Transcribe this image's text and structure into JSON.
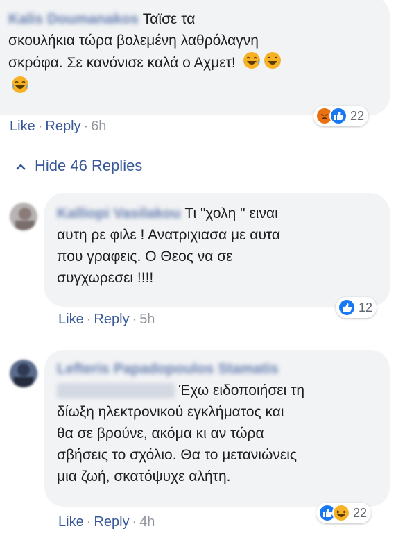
{
  "comments": [
    {
      "author": "Kalis Doumanakos",
      "text": "Ταϊσε τα σκουλήκια τώρα βολεμένη λαθρόλαγνη σκρόφα. Σε κανόνισε καλά ο Αχμετ!",
      "line1": "Ταϊσε τα",
      "line2": "σκουλήκια τώρα βολεμένη λαθρόλαγνη",
      "line3": "σκρόφα. Σε κανόνισε καλά ο Αχμετ!",
      "like": "Like",
      "reply": "Reply",
      "time": "6h",
      "reaction_count": "22",
      "reactions": [
        "angry-icon",
        "like-icon"
      ]
    },
    {
      "author": "Kalliopi Vasilakou",
      "line1": "Τι \"χολη \" ειναι",
      "line2": "αυτη ρε φιλε ! Ανατριχιασα με αυτα",
      "line3": "που γραφεις. Ο Θεος να σε",
      "line4": "συγχωρεσει !!!!",
      "like": "Like",
      "reply": "Reply",
      "time": "5h",
      "reaction_count": "12",
      "reactions": [
        "like-icon"
      ]
    },
    {
      "author": "Lefteris Papadopoulos Stamatis",
      "line1": "Έχω ειδοποιήσει τη",
      "line2": "δίωξη ηλεκτρονικού εγκλήματος και",
      "line3": "θα σε βρούνε, ακόμα κι αν τώρα",
      "line4": "σβήσεις το σχόλιο. Θα το μετανιώνεις",
      "line5": "μια ζωή, σκατόψυχε αλήτη.",
      "like": "Like",
      "reply": "Reply",
      "time": "4h",
      "reaction_count": "22",
      "reactions": [
        "like-icon",
        "haha-icon"
      ]
    }
  ],
  "hide_replies": "Hide 46 Replies",
  "colors": {
    "link": "#385898",
    "bubble": "#f2f3f5",
    "like_blue": "#1877f2",
    "angry": "#e9710f",
    "haha": "#f7b125"
  }
}
